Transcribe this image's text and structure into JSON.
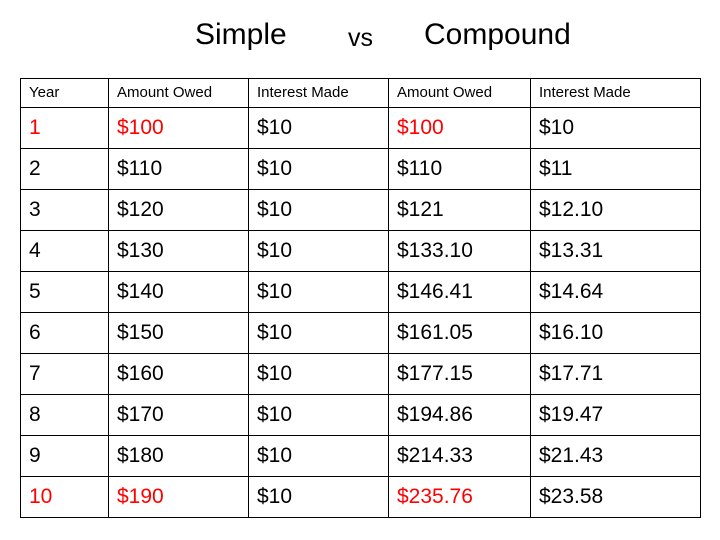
{
  "title": {
    "left": "Simple",
    "middle": "vs",
    "right": "Compound"
  },
  "colors": {
    "highlight": "#ff0000",
    "text": "#000000",
    "border": "#000000",
    "background": "#ffffff"
  },
  "table": {
    "headers": [
      "Year",
      "Amount Owed",
      "Interest Made",
      "Amount Owed",
      "Interest Made"
    ],
    "rows": [
      {
        "year": "1",
        "simple_owed": "$100",
        "simple_interest": "$10",
        "compound_owed": "$100",
        "compound_interest": "$10"
      },
      {
        "year": "2",
        "simple_owed": "$110",
        "simple_interest": "$10",
        "compound_owed": "$110",
        "compound_interest": "$11"
      },
      {
        "year": "3",
        "simple_owed": "$120",
        "simple_interest": "$10",
        "compound_owed": "$121",
        "compound_interest": "$12.10"
      },
      {
        "year": "4",
        "simple_owed": "$130",
        "simple_interest": "$10",
        "compound_owed": "$133.10",
        "compound_interest": "$13.31"
      },
      {
        "year": "5",
        "simple_owed": "$140",
        "simple_interest": "$10",
        "compound_owed": "$146.41",
        "compound_interest": "$14.64"
      },
      {
        "year": "6",
        "simple_owed": "$150",
        "simple_interest": "$10",
        "compound_owed": "$161.05",
        "compound_interest": "$16.10"
      },
      {
        "year": "7",
        "simple_owed": "$160",
        "simple_interest": "$10",
        "compound_owed": "$177.15",
        "compound_interest": "$17.71"
      },
      {
        "year": "8",
        "simple_owed": "$170",
        "simple_interest": "$10",
        "compound_owed": "$194.86",
        "compound_interest": "$19.47"
      },
      {
        "year": "9",
        "simple_owed": "$180",
        "simple_interest": "$10",
        "compound_owed": "$214.33",
        "compound_interest": "$21.43"
      },
      {
        "year": "10",
        "simple_owed": "$190",
        "simple_interest": "$10",
        "compound_owed": "$235.76",
        "compound_interest": "$23.58"
      }
    ]
  }
}
